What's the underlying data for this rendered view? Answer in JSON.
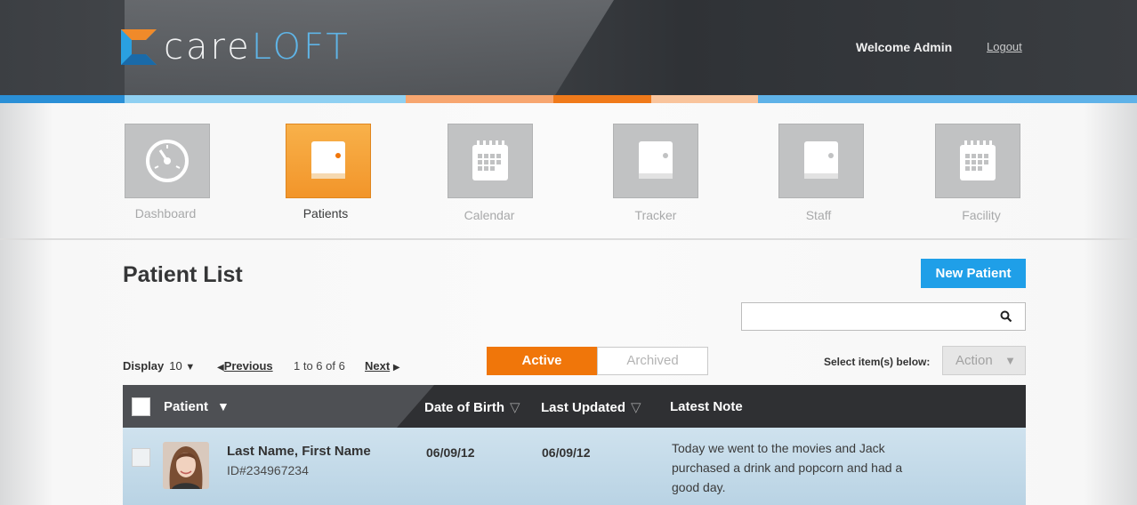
{
  "header": {
    "logo_part1": "care",
    "logo_part2": "LOFT",
    "welcome": "Welcome Admin",
    "logout": "Logout"
  },
  "nav": {
    "items": [
      {
        "label": "Dashboard",
        "icon": "gauge-icon"
      },
      {
        "label": "Patients",
        "icon": "book-icon",
        "active": true
      },
      {
        "label": "Calendar",
        "icon": "calendar-icon"
      },
      {
        "label": "Tracker",
        "icon": "book-icon"
      },
      {
        "label": "Staff",
        "icon": "book-icon"
      },
      {
        "label": "Facility",
        "icon": "calendar-icon"
      }
    ]
  },
  "page": {
    "title": "Patient List",
    "new_button": "New Patient",
    "search_placeholder": ""
  },
  "controls": {
    "display_label": "Display",
    "display_value": "10",
    "previous": "Previous",
    "range": "1 to 6 of 6",
    "next": "Next",
    "tab_active": "Active",
    "tab_archived": "Archived",
    "select_label": "Select item(s) below:",
    "action": "Action"
  },
  "table": {
    "columns": [
      "Patient",
      "Date of Birth",
      "Last Updated",
      "Latest Note"
    ],
    "rows": [
      {
        "name": "Last Name, First Name",
        "id": "ID#234967234",
        "dob": "06/09/12",
        "updated": "06/09/12",
        "note": "Today we went to the movies and Jack purchased a drink and popcorn and had a good day."
      }
    ]
  },
  "colors": {
    "accent_orange": "#f0760a",
    "accent_blue": "#1f9fe8",
    "header_dark": "#3c3f43"
  }
}
